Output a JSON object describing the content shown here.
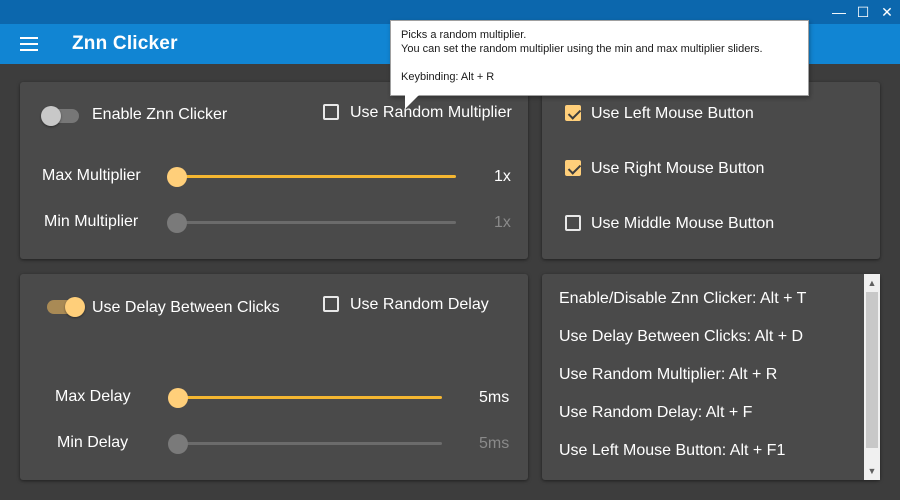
{
  "window": {
    "minimize": "—",
    "maximize": "☐",
    "close": "✕"
  },
  "app": {
    "title": "Znn Clicker",
    "menu_icon": "hamburger-icon"
  },
  "colors": {
    "accent": "#ffcf7a",
    "titlebar": "#0c67ad",
    "appbar": "#1185d3",
    "card": "#4a4a4a",
    "background": "#3d3d3d"
  },
  "main_panel": {
    "enable_label": "Enable Znn Clicker",
    "enable_on": false,
    "random_multiplier_label": "Use Random Multiplier",
    "random_multiplier_checked": false,
    "max_multiplier": {
      "label": "Max Multiplier",
      "value_text": "1x",
      "position": 1.0
    },
    "min_multiplier": {
      "label": "Min Multiplier",
      "value_text": "1x",
      "position": 0.0
    }
  },
  "mouse_panel": {
    "left": {
      "label": "Use Left Mouse Button",
      "checked": true
    },
    "right": {
      "label": "Use Right Mouse Button",
      "checked": true
    },
    "middle": {
      "label": "Use Middle Mouse Button",
      "checked": false
    }
  },
  "delay_panel": {
    "delay_label": "Use Delay Between Clicks",
    "delay_on": true,
    "random_delay_label": "Use Random Delay",
    "random_delay_checked": false,
    "max_delay": {
      "label": "Max Delay",
      "value_text": "5ms",
      "position": 1.0
    },
    "min_delay": {
      "label": "Min Delay",
      "value_text": "5ms",
      "position": 0.0
    }
  },
  "keybindings": [
    "Enable/Disable Znn Clicker: Alt + T",
    "Use Delay Between Clicks: Alt + D",
    "Use Random Multiplier: Alt + R",
    "Use Random Delay: Alt + F",
    "Use Left Mouse Button: Alt + F1"
  ],
  "tooltip": {
    "line1": "Picks a random multiplier.",
    "line2": "You can set the random multiplier using the min and max multiplier sliders.",
    "line3": "Keybinding: Alt + R"
  },
  "scrollbar": {
    "up_icon": "chevron-up-icon",
    "down_icon": "chevron-down-icon"
  }
}
